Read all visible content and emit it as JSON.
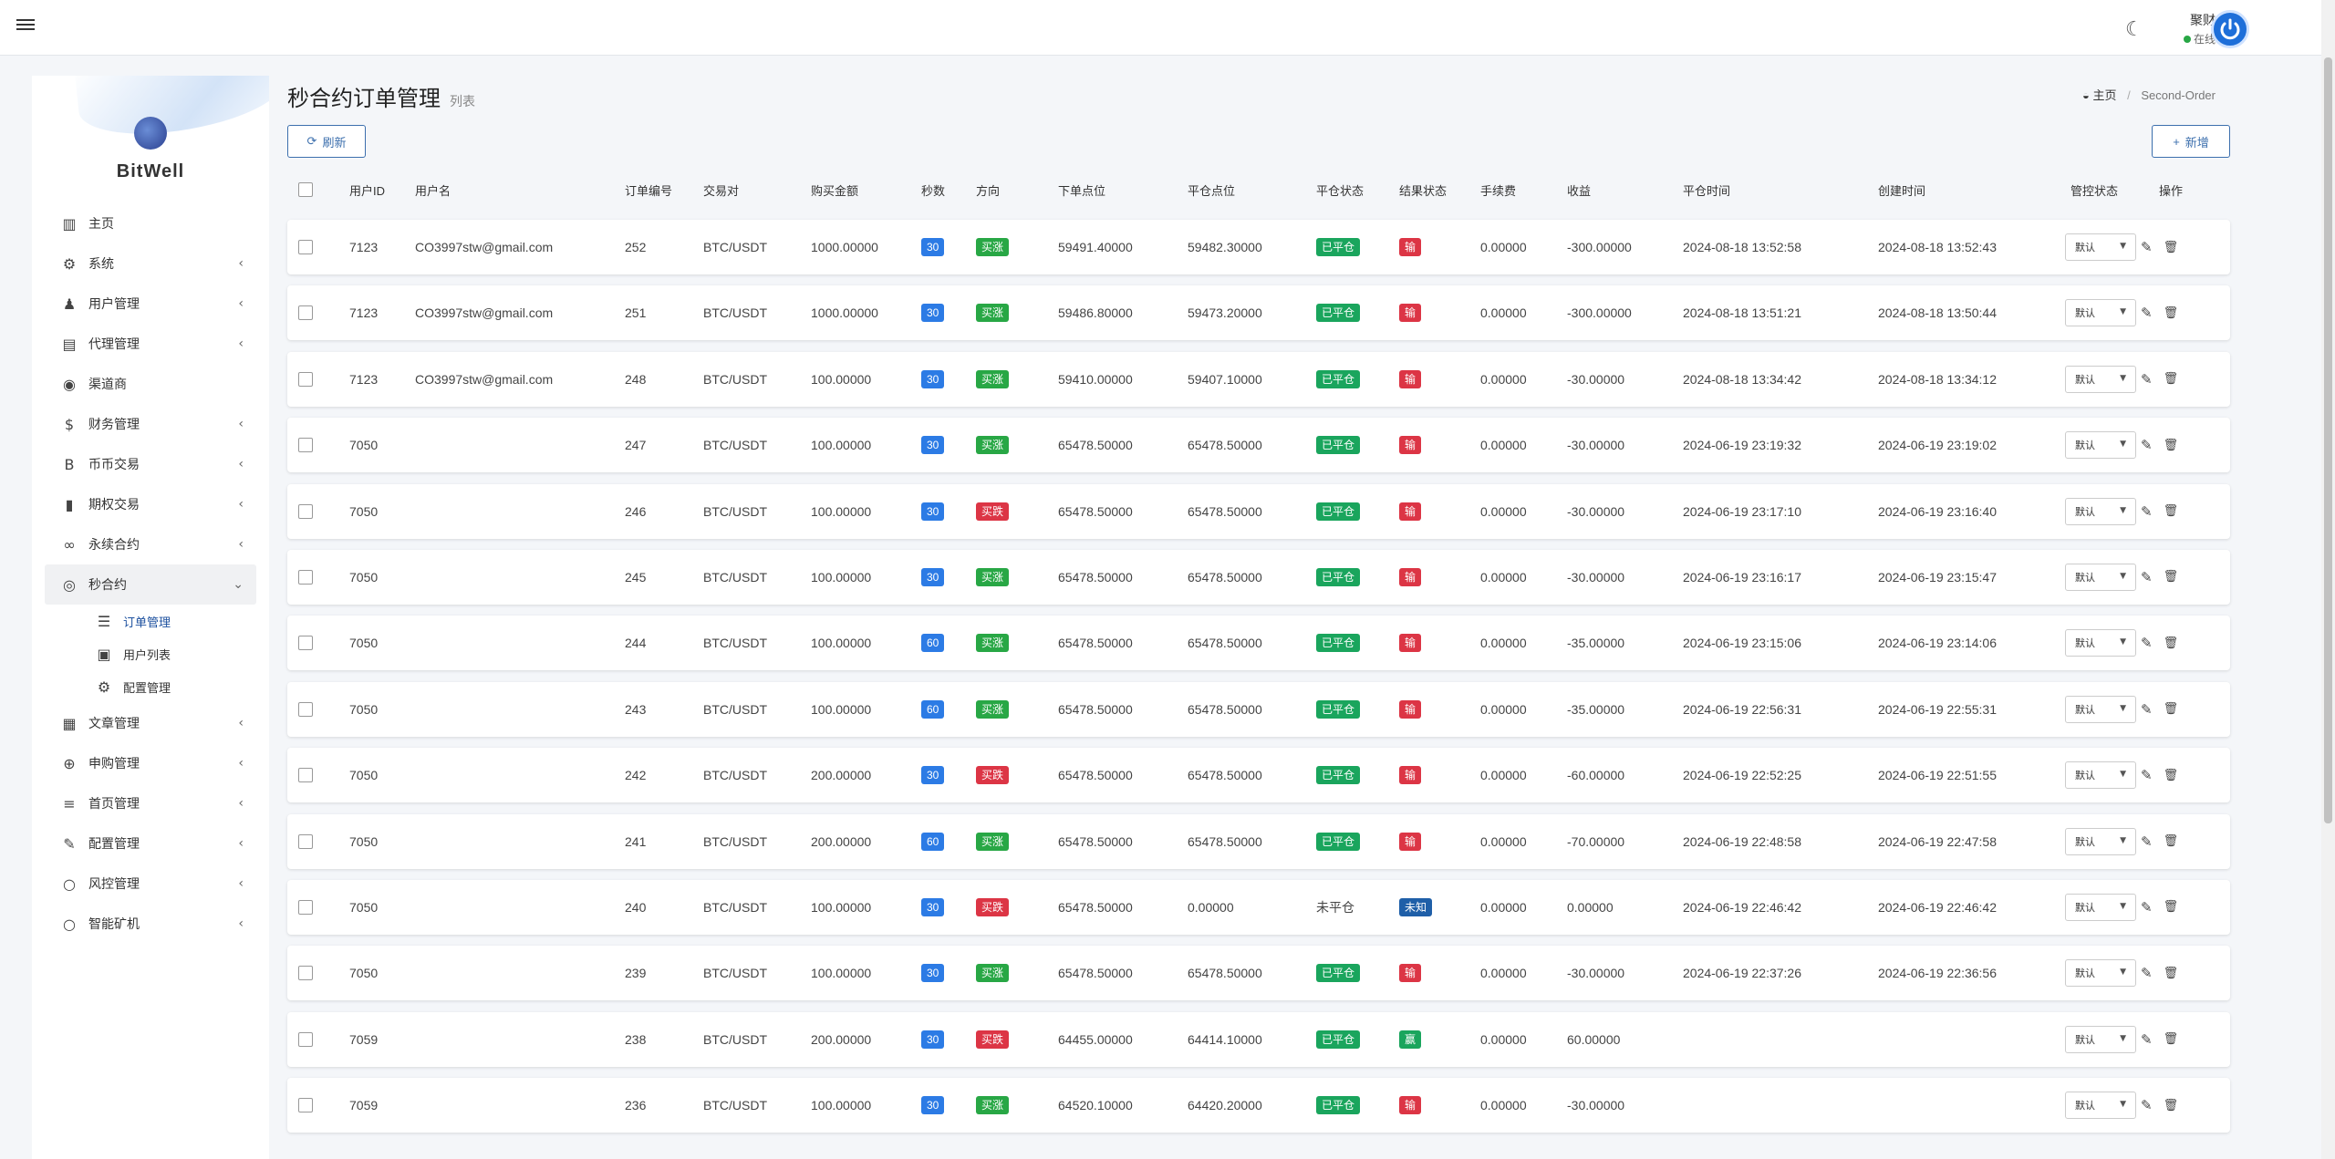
{
  "header": {
    "user_name": "聚财",
    "user_status": "在线"
  },
  "sidebar": {
    "brand": "BitWell",
    "items": [
      {
        "label": "主页",
        "icon": "chart-icon",
        "glyph": "▥",
        "arrow": false
      },
      {
        "label": "系统",
        "icon": "gear-icon",
        "glyph": "⚙",
        "arrow": true
      },
      {
        "label": "用户管理",
        "icon": "user-icon",
        "glyph": "♟",
        "arrow": true
      },
      {
        "label": "代理管理",
        "icon": "id-card-icon",
        "glyph": "▤",
        "arrow": true
      },
      {
        "label": "渠道商",
        "icon": "user-circle-icon",
        "glyph": "◉",
        "arrow": false
      },
      {
        "label": "财务管理",
        "icon": "dollar-icon",
        "glyph": "$",
        "arrow": true
      },
      {
        "label": "币币交易",
        "icon": "bitcoin-icon",
        "glyph": "B",
        "arrow": true
      },
      {
        "label": "期权交易",
        "icon": "book-icon",
        "glyph": "▮",
        "arrow": true
      },
      {
        "label": "永续合约",
        "icon": "link-icon",
        "glyph": "∞",
        "arrow": true
      },
      {
        "label": "秒合约",
        "icon": "target-icon",
        "glyph": "◎",
        "arrow": true
      }
    ],
    "submenu": [
      {
        "label": "订单管理",
        "icon": "list-icon",
        "glyph": "☰"
      },
      {
        "label": "用户列表",
        "icon": "portrait-icon",
        "glyph": "▣"
      },
      {
        "label": "配置管理",
        "icon": "cog-icon",
        "glyph": "⚙"
      }
    ],
    "items_after": [
      {
        "label": "文章管理",
        "icon": "newspaper-icon",
        "glyph": "▦"
      },
      {
        "label": "申购管理",
        "icon": "globe-icon",
        "glyph": "⊕"
      },
      {
        "label": "首页管理",
        "icon": "bars-icon",
        "glyph": "≡"
      },
      {
        "label": "配置管理",
        "icon": "wrench-icon",
        "glyph": "✎"
      },
      {
        "label": "风控管理",
        "icon": "circle-icon",
        "glyph": "○"
      },
      {
        "label": "智能矿机",
        "icon": "circle-icon",
        "glyph": "○"
      }
    ]
  },
  "page": {
    "title": "秒合约订单管理",
    "subtitle": "列表",
    "breadcrumb_home": "主页",
    "breadcrumb_sep": "/",
    "breadcrumb_current": "Second-Order",
    "refresh_label": "刷新",
    "add_label": "新增"
  },
  "table": {
    "columns": [
      "用户ID",
      "用户名",
      "订单编号",
      "交易对",
      "购买金额",
      "秒数",
      "方向",
      "下单点位",
      "平仓点位",
      "平仓状态",
      "结果状态",
      "手续费",
      "收益",
      "平仓时间",
      "创建时间",
      "管控状态",
      "操作"
    ],
    "select_value": "默认",
    "rows": [
      {
        "uid": "7123",
        "name": "CO3997stw@gmail.com",
        "no": "252",
        "pair": "BTC/USDT",
        "amount": "1000.00000",
        "sec": "30",
        "dir": "买涨",
        "open": "59491.40000",
        "close": "59482.30000",
        "close_state": "已平仓",
        "result": "输",
        "fee": "0.00000",
        "profit": "-300.00000",
        "close_time": "2024-08-18 13:52:58",
        "create_time": "2024-08-18 13:52:43"
      },
      {
        "uid": "7123",
        "name": "CO3997stw@gmail.com",
        "no": "251",
        "pair": "BTC/USDT",
        "amount": "1000.00000",
        "sec": "30",
        "dir": "买涨",
        "open": "59486.80000",
        "close": "59473.20000",
        "close_state": "已平仓",
        "result": "输",
        "fee": "0.00000",
        "profit": "-300.00000",
        "close_time": "2024-08-18 13:51:21",
        "create_time": "2024-08-18 13:50:44"
      },
      {
        "uid": "7123",
        "name": "CO3997stw@gmail.com",
        "no": "248",
        "pair": "BTC/USDT",
        "amount": "100.00000",
        "sec": "30",
        "dir": "买涨",
        "open": "59410.00000",
        "close": "59407.10000",
        "close_state": "已平仓",
        "result": "输",
        "fee": "0.00000",
        "profit": "-30.00000",
        "close_time": "2024-08-18 13:34:42",
        "create_time": "2024-08-18 13:34:12"
      },
      {
        "uid": "7050",
        "name": "",
        "no": "247",
        "pair": "BTC/USDT",
        "amount": "100.00000",
        "sec": "30",
        "dir": "买涨",
        "open": "65478.50000",
        "close": "65478.50000",
        "close_state": "已平仓",
        "result": "输",
        "fee": "0.00000",
        "profit": "-30.00000",
        "close_time": "2024-06-19 23:19:32",
        "create_time": "2024-06-19 23:19:02"
      },
      {
        "uid": "7050",
        "name": "",
        "no": "246",
        "pair": "BTC/USDT",
        "amount": "100.00000",
        "sec": "30",
        "dir": "买跌",
        "open": "65478.50000",
        "close": "65478.50000",
        "close_state": "已平仓",
        "result": "输",
        "fee": "0.00000",
        "profit": "-30.00000",
        "close_time": "2024-06-19 23:17:10",
        "create_time": "2024-06-19 23:16:40"
      },
      {
        "uid": "7050",
        "name": "",
        "no": "245",
        "pair": "BTC/USDT",
        "amount": "100.00000",
        "sec": "30",
        "dir": "买涨",
        "open": "65478.50000",
        "close": "65478.50000",
        "close_state": "已平仓",
        "result": "输",
        "fee": "0.00000",
        "profit": "-30.00000",
        "close_time": "2024-06-19 23:16:17",
        "create_time": "2024-06-19 23:15:47"
      },
      {
        "uid": "7050",
        "name": "",
        "no": "244",
        "pair": "BTC/USDT",
        "amount": "100.00000",
        "sec": "60",
        "dir": "买涨",
        "open": "65478.50000",
        "close": "65478.50000",
        "close_state": "已平仓",
        "result": "输",
        "fee": "0.00000",
        "profit": "-35.00000",
        "close_time": "2024-06-19 23:15:06",
        "create_time": "2024-06-19 23:14:06"
      },
      {
        "uid": "7050",
        "name": "",
        "no": "243",
        "pair": "BTC/USDT",
        "amount": "100.00000",
        "sec": "60",
        "dir": "买涨",
        "open": "65478.50000",
        "close": "65478.50000",
        "close_state": "已平仓",
        "result": "输",
        "fee": "0.00000",
        "profit": "-35.00000",
        "close_time": "2024-06-19 22:56:31",
        "create_time": "2024-06-19 22:55:31"
      },
      {
        "uid": "7050",
        "name": "",
        "no": "242",
        "pair": "BTC/USDT",
        "amount": "200.00000",
        "sec": "30",
        "dir": "买跌",
        "open": "65478.50000",
        "close": "65478.50000",
        "close_state": "已平仓",
        "result": "输",
        "fee": "0.00000",
        "profit": "-60.00000",
        "close_time": "2024-06-19 22:52:25",
        "create_time": "2024-06-19 22:51:55"
      },
      {
        "uid": "7050",
        "name": "",
        "no": "241",
        "pair": "BTC/USDT",
        "amount": "200.00000",
        "sec": "60",
        "dir": "买涨",
        "open": "65478.50000",
        "close": "65478.50000",
        "close_state": "已平仓",
        "result": "输",
        "fee": "0.00000",
        "profit": "-70.00000",
        "close_time": "2024-06-19 22:48:58",
        "create_time": "2024-06-19 22:47:58"
      },
      {
        "uid": "7050",
        "name": "",
        "no": "240",
        "pair": "BTC/USDT",
        "amount": "100.00000",
        "sec": "30",
        "dir": "买跌",
        "open": "65478.50000",
        "close": "0.00000",
        "close_state": "未平仓",
        "result": "未知",
        "fee": "0.00000",
        "profit": "0.00000",
        "close_time": "2024-06-19 22:46:42",
        "create_time": "2024-06-19 22:46:42"
      },
      {
        "uid": "7050",
        "name": "",
        "no": "239",
        "pair": "BTC/USDT",
        "amount": "100.00000",
        "sec": "30",
        "dir": "买涨",
        "open": "65478.50000",
        "close": "65478.50000",
        "close_state": "已平仓",
        "result": "输",
        "fee": "0.00000",
        "profit": "-30.00000",
        "close_time": "2024-06-19 22:37:26",
        "create_time": "2024-06-19 22:36:56"
      },
      {
        "uid": "7059",
        "name": "",
        "no": "238",
        "pair": "BTC/USDT",
        "amount": "200.00000",
        "sec": "30",
        "dir": "买跌",
        "open": "64455.00000",
        "close": "64414.10000",
        "close_state": "已平仓",
        "result": "赢",
        "fee": "0.00000",
        "profit": "60.00000",
        "close_time": "",
        "create_time": ""
      },
      {
        "uid": "7059",
        "name": "",
        "no": "236",
        "pair": "BTC/USDT",
        "amount": "100.00000",
        "sec": "30",
        "dir": "买涨",
        "open": "64520.10000",
        "close": "64420.20000",
        "close_state": "已平仓",
        "result": "输",
        "fee": "0.00000",
        "profit": "-30.00000",
        "close_time": "",
        "create_time": ""
      }
    ]
  },
  "colors": {
    "accent": "#3c6fad",
    "blue_badge": "#2c7be5",
    "green_badge": "#28a745",
    "red_badge": "#dc3545"
  }
}
